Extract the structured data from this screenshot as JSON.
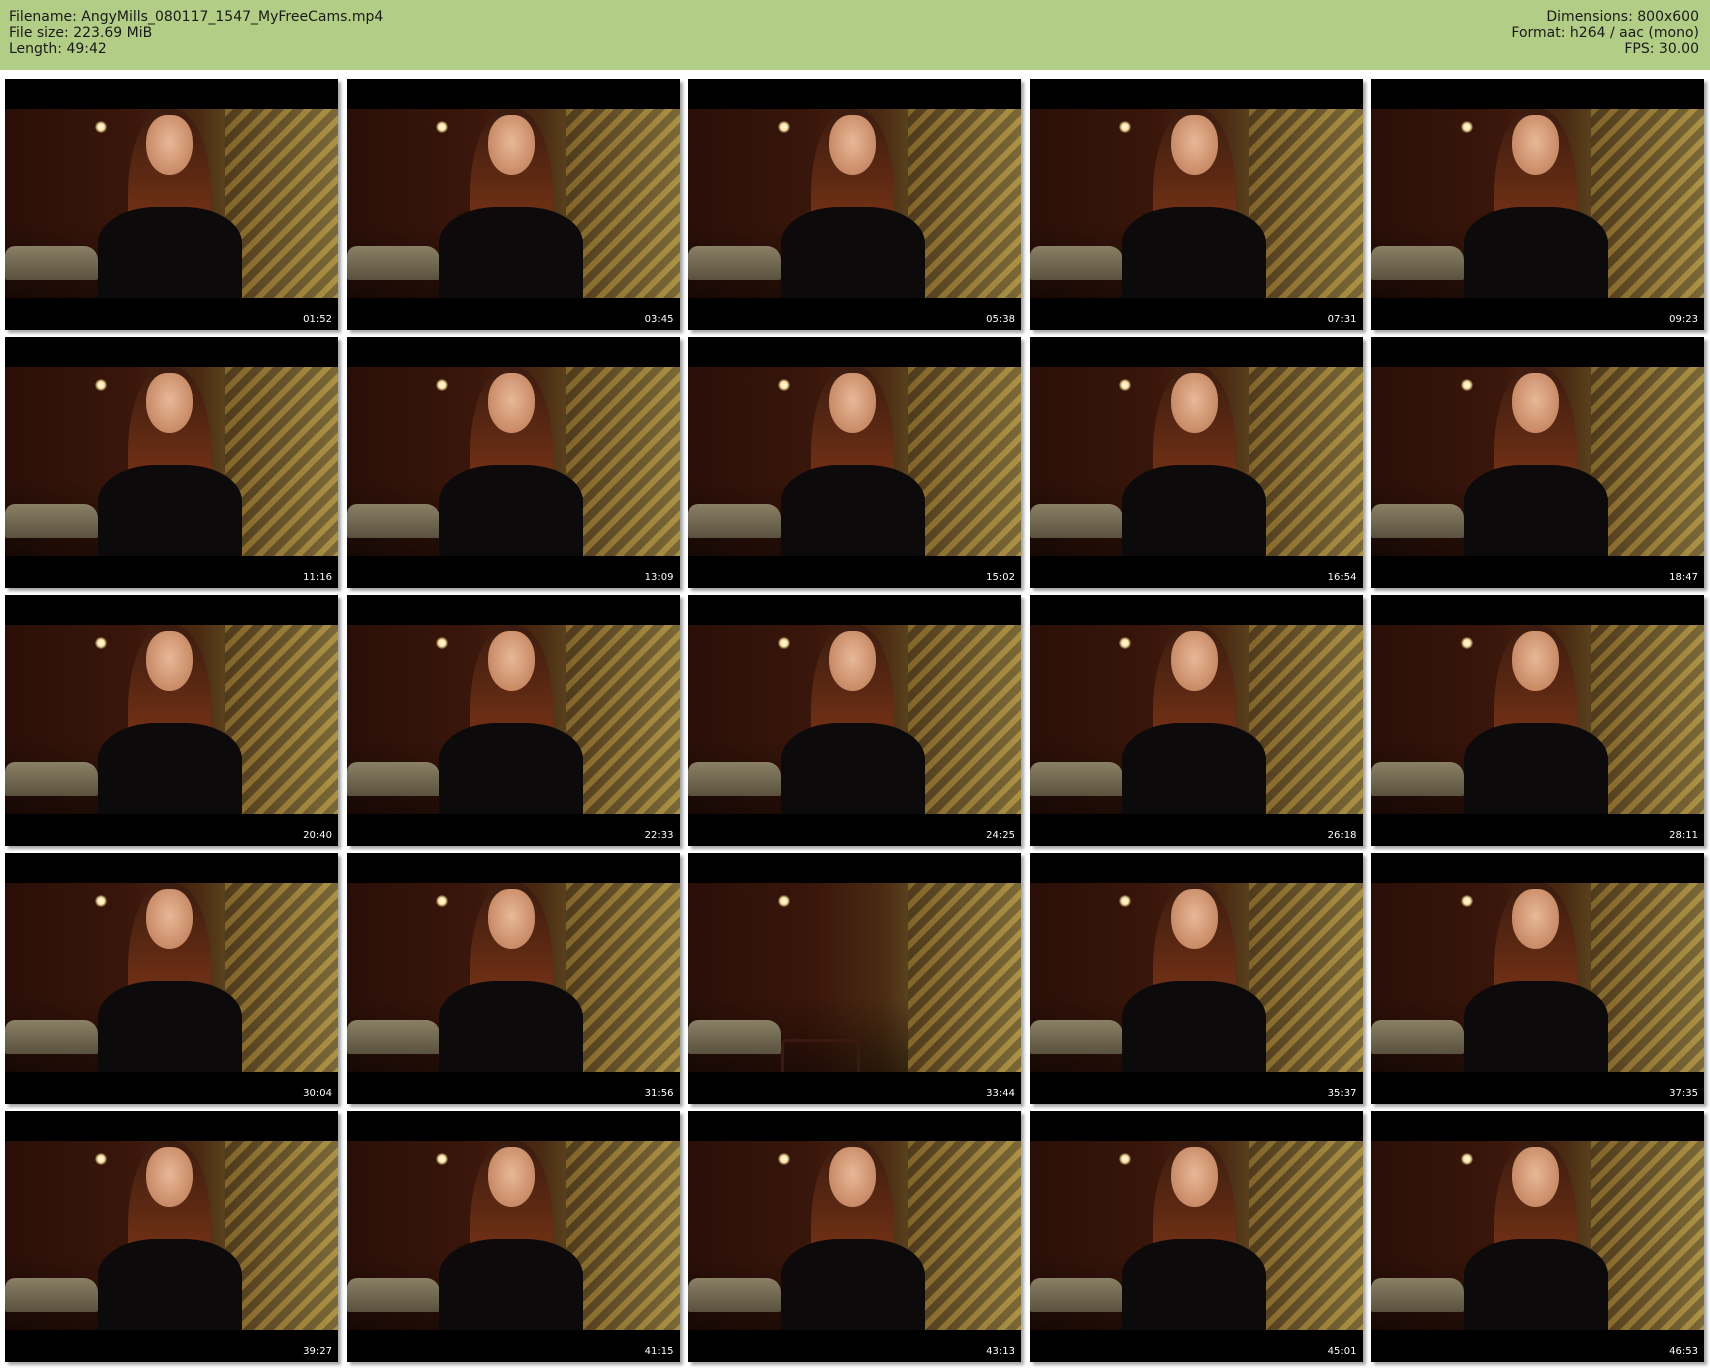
{
  "header": {
    "filename": "Filename: AngyMills_080117_1547_MyFreeCams.mp4",
    "filesize": "File size: 223.69 MiB",
    "length": "Length: 49:42",
    "dimensions": "Dimensions: 800x600",
    "format": "Format: h264 / aac (mono)",
    "fps": "FPS: 30.00"
  },
  "thumbnails": [
    {
      "time": "01:52"
    },
    {
      "time": "03:45"
    },
    {
      "time": "05:38"
    },
    {
      "time": "07:31"
    },
    {
      "time": "09:23"
    },
    {
      "time": "11:16"
    },
    {
      "time": "13:09"
    },
    {
      "time": "15:02"
    },
    {
      "time": "16:54"
    },
    {
      "time": "18:47"
    },
    {
      "time": "20:40"
    },
    {
      "time": "22:33"
    },
    {
      "time": "24:25"
    },
    {
      "time": "26:18"
    },
    {
      "time": "28:11"
    },
    {
      "time": "30:04"
    },
    {
      "time": "31:56"
    },
    {
      "time": "33:44",
      "empty_scene": true
    },
    {
      "time": "35:37"
    },
    {
      "time": "37:35"
    },
    {
      "time": "39:27"
    },
    {
      "time": "41:15"
    },
    {
      "time": "43:13"
    },
    {
      "time": "45:01"
    },
    {
      "time": "46:53"
    }
  ]
}
